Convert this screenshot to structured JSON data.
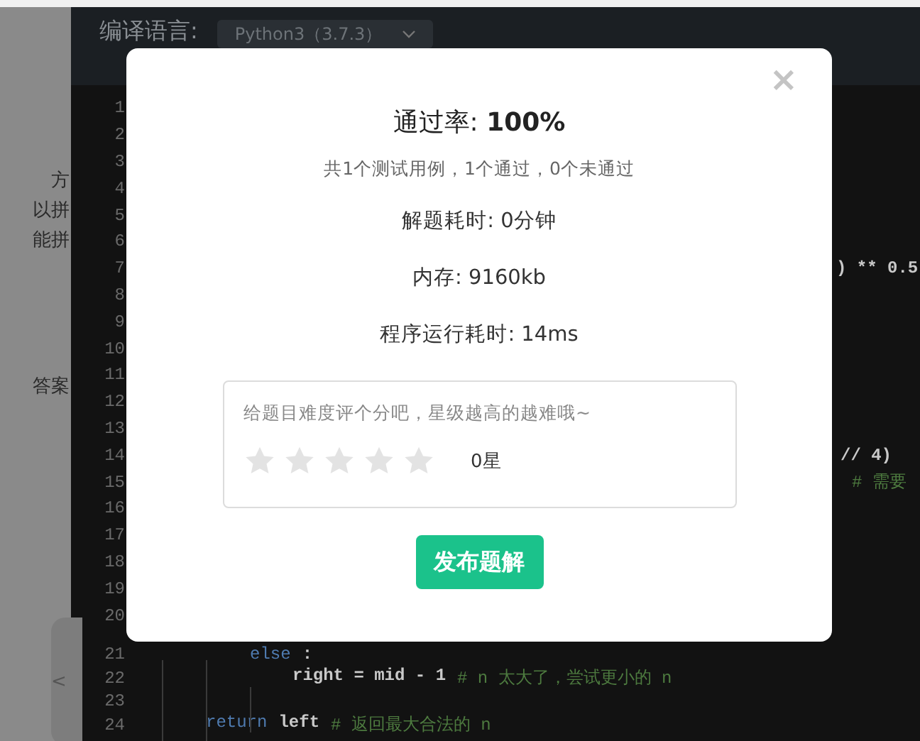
{
  "sidebar": {
    "fragments": [
      "方",
      "以拼",
      "能拼",
      "答案"
    ]
  },
  "editor": {
    "language_label": "编译语言:",
    "language_select": "Python3（3.7.3）",
    "lines": [
      {
        "number": "1"
      },
      {
        "number": "2"
      },
      {
        "number": "3"
      },
      {
        "number": "4"
      },
      {
        "number": "5"
      },
      {
        "number": "6"
      },
      {
        "number": "7",
        "segments": [
          {
            "kind": "plain",
            "text": ") ** 0.5"
          }
        ]
      },
      {
        "number": "8"
      },
      {
        "number": "9"
      },
      {
        "number": "10"
      },
      {
        "number": "11"
      },
      {
        "number": "12"
      },
      {
        "number": "13"
      },
      {
        "number": "14",
        "segments": [
          {
            "kind": "plain",
            "text": "// 4)"
          }
        ]
      },
      {
        "number": "15",
        "segments": [
          {
            "kind": "comment",
            "text": "# 需要"
          }
        ]
      },
      {
        "number": "16"
      },
      {
        "number": "17"
      },
      {
        "number": "18"
      },
      {
        "number": "19"
      },
      {
        "number": "20"
      },
      {
        "number": "21",
        "segments": [
          {
            "kind": "keyword",
            "text": "else"
          },
          {
            "kind": "plain",
            "text": ":"
          }
        ]
      },
      {
        "number": "22",
        "segments": [
          {
            "kind": "plain",
            "text": "right = mid - 1"
          },
          {
            "kind": "comment",
            "text": "# n 太大了，尝试更小的 n"
          }
        ]
      },
      {
        "number": "23"
      },
      {
        "number": "24",
        "segments": [
          {
            "kind": "keyword",
            "text": "return"
          },
          {
            "kind": "plain",
            "text": "left"
          },
          {
            "kind": "comment",
            "text": "# 返回最大合法的 n"
          }
        ]
      }
    ]
  },
  "collapse_handle": "<",
  "dialog": {
    "close": "×",
    "title": "通过率: **100%**",
    "summary": "共1个测试用例，1个通过，0个未通过",
    "stats": [
      "解题耗时: 0分钟",
      "内存: 9160kb",
      "程序运行耗时: 14ms"
    ],
    "rating": {
      "hint": "给题目难度评个分吧，星级越高的越难哦~",
      "stars": 0,
      "reading": "0星"
    },
    "button": "发布题解"
  }
}
